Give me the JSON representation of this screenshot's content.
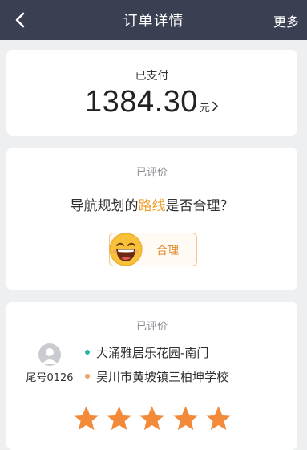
{
  "header": {
    "title": "订单详情",
    "more_label": "更多"
  },
  "payment": {
    "status": "已支付",
    "amount": "1384.30",
    "unit": "元"
  },
  "route_review": {
    "status": "已评价",
    "question_prefix": "导航规划的",
    "question_highlight": "路线",
    "question_suffix": "是否合理？",
    "answer_label": "合理",
    "highlight_color": "#f0a030"
  },
  "driver_review": {
    "status": "已评价",
    "tail_number": "尾号0126",
    "pickup": "大涌雅居乐花园-南门",
    "dropoff": "吴川市黄坡镇三柏坤学校",
    "pickup_dot_color": "#27b5a0",
    "dropoff_dot_color": "#f0a060",
    "rating": 5,
    "max_rating": 5,
    "star_color": "#f28a3a"
  }
}
